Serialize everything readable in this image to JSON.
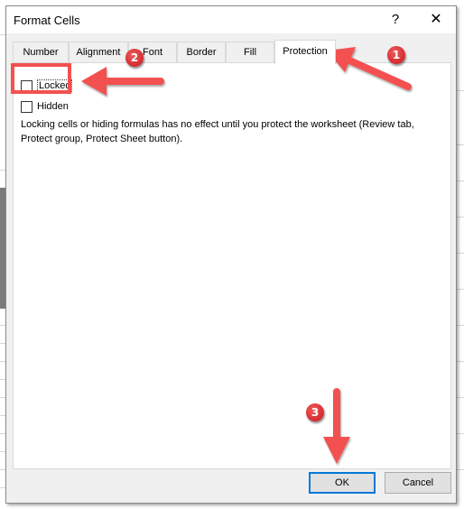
{
  "dialog": {
    "title": "Format Cells",
    "help_label": "?",
    "close_label": "✕",
    "icons": {
      "help": "question-mark-icon",
      "close": "close-icon"
    }
  },
  "tabs": [
    {
      "label": "Number",
      "active": false
    },
    {
      "label": "Alignment",
      "active": false
    },
    {
      "label": "Font",
      "active": false
    },
    {
      "label": "Border",
      "active": false
    },
    {
      "label": "Fill",
      "active": false
    },
    {
      "label": "Protection",
      "active": true
    }
  ],
  "protection": {
    "locked": {
      "label": "Locked",
      "checked": false
    },
    "hidden": {
      "label": "Hidden",
      "checked": false
    },
    "description": "Locking cells or hiding formulas has no effect until you protect the worksheet (Review tab, Protect group, Protect Sheet button)."
  },
  "buttons": {
    "ok": "OK",
    "cancel": "Cancel"
  },
  "annotations": {
    "color": "#f2514f",
    "badges": [
      "1",
      "2",
      "3"
    ]
  }
}
